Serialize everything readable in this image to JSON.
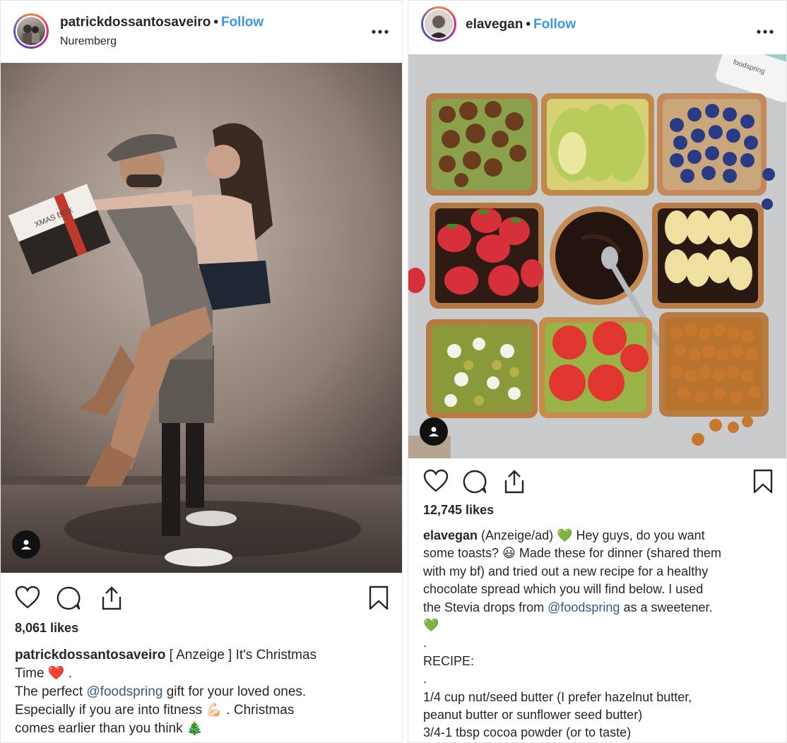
{
  "left_post": {
    "username": "patrickdossantosaveiro",
    "separator": "•",
    "follow_label": "Follow",
    "location": "Nuremberg",
    "more_label": "•••",
    "box_text": "XMAS BOX",
    "likes": "8,061 likes",
    "caption": {
      "username": "patrickdossantosaveiro",
      "line1": " [ Anzeige ] It's Christmas",
      "line2a": "Time ",
      "emoji_heart": "❤️",
      "line2b": " .",
      "line3a": "The perfect ",
      "mention": "@foodspring",
      "line3b": " gift for your loved ones.",
      "line4a": "Especially if you are into fitness ",
      "emoji_muscle": "💪🏻",
      "line4b": " . Christmas",
      "line5a": "comes earlier than you think ",
      "emoji_tree": "🎄"
    }
  },
  "right_post": {
    "username": "elavegan",
    "separator": "•",
    "follow_label": "Follow",
    "more_label": "•••",
    "bottle_text": "foodspring",
    "likes": "12,745 likes",
    "caption": {
      "username": "elavegan",
      "line1": " (Anzeige/ad) ",
      "emoji_green_heart": "💚",
      "line1b": " Hey guys, do you want",
      "line2a": "some toasts? ",
      "emoji_smile": "😃",
      "line2b": " Made these for dinner (shared them",
      "line3": "with my bf) and tried out a new recipe for a healthy",
      "line4": "chocolate spread which you will find below. I used",
      "line5a": "the Stevia drops from ",
      "mention": "@foodspring",
      "line5b": " as a sweetener.",
      "emoji_green_heart_2": "💚",
      "dot1": ".",
      "recipe": "RECIPE:",
      "dot2": ".",
      "ingredient1a": "1/4 cup nut/seed butter (I prefer hazelnut butter,",
      "ingredient1b": "peanut butter or sunflower seed butter)",
      "ingredient2": "3/4-1 tbsp cocoa powder (or to taste)"
    }
  },
  "colors": {
    "follow": "#3897f0",
    "text": "#262626",
    "border": "#e6e6e6"
  }
}
